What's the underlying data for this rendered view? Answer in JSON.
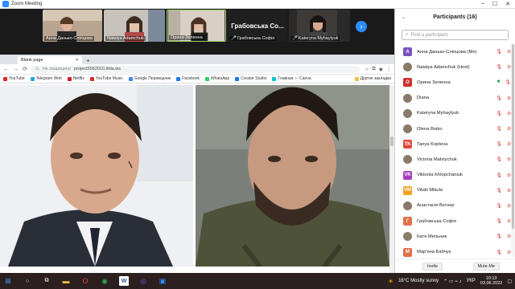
{
  "window": {
    "title": "Zoom Meeting"
  },
  "gallery": {
    "tiles": [
      {
        "name": "Анна Данько-Сліпцова",
        "type": "video"
      },
      {
        "name": "Natalya Adamchuk",
        "type": "video"
      },
      {
        "name": "Орина Зеленна",
        "type": "video"
      },
      {
        "name": "Грабовська Софія",
        "big_label": "Грабовська   Со...",
        "type": "text"
      },
      {
        "name": "Kateryna Myhaylyuk",
        "type": "video"
      }
    ]
  },
  "browser": {
    "tab_title": "Blank page",
    "url_warning": "Не защищено",
    "url": "project5562010.tilda.ws",
    "bookmarks": [
      {
        "label": "YouTube",
        "color": "#e02828"
      },
      {
        "label": "Telegram Web",
        "color": "#2aa3e0"
      },
      {
        "label": "Netflix",
        "color": "#d81f26"
      },
      {
        "label": "YouTube Music",
        "color": "#e02828"
      },
      {
        "label": "Google Переводчик",
        "color": "#4285f4"
      },
      {
        "label": "Facebook",
        "color": "#1877f2"
      },
      {
        "label": "WhatsApp",
        "color": "#25d366"
      },
      {
        "label": "Creator Studio",
        "color": "#1877f2"
      },
      {
        "label": "Главная — Canva",
        "color": "#00c4cc"
      }
    ],
    "other_bookmarks": "Другие закладки"
  },
  "participants": {
    "title": "Participants (16)",
    "search_placeholder": "Find a participant",
    "list": [
      {
        "name": "Анна Данько-Сліпцова (Me)",
        "initial": "А",
        "color": "#7b4fbf",
        "icons": [
          "mic-off",
          "video-off"
        ]
      },
      {
        "name": "Natalya Adamchuk (Host)",
        "initial": "",
        "color": "#8a7a6a",
        "icons": [
          "mic-off",
          "video-off"
        ]
      },
      {
        "name": "Орина Зеленна",
        "initial": "О",
        "color": "#d0312d",
        "icons": [
          "video-on",
          "mic-off"
        ]
      },
      {
        "name": "Diana",
        "initial": "",
        "color": "#8a7a6a",
        "icons": [
          "mic-off",
          "video-off"
        ]
      },
      {
        "name": "Kateryna Myhaylyuk",
        "initial": "",
        "color": "#8a7a6a",
        "icons": [
          "mic-off",
          "video-off"
        ]
      },
      {
        "name": "Olena Boiko",
        "initial": "",
        "color": "#8a7a6a",
        "icons": [
          "mic-off",
          "video-off"
        ]
      },
      {
        "name": "Tanya Kopteva",
        "initial": "TK",
        "color": "#e0473b",
        "icons": [
          "mic-off",
          "video-off"
        ]
      },
      {
        "name": "Victoria Matviychuk",
        "initial": "",
        "color": "#8a7a6a",
        "icons": [
          "mic-off",
          "video-off"
        ]
      },
      {
        "name": "Viktoriia Khlopchaniuk",
        "initial": "VK",
        "color": "#a83bbf",
        "icons": [
          "mic-off",
          "video-off"
        ]
      },
      {
        "name": "Vitalii Mikula",
        "initial": "VM",
        "color": "#f0a020",
        "icons": [
          "mic-off",
          "video-off"
        ]
      },
      {
        "name": "Анастасія Вєгнер",
        "initial": "",
        "color": "#8a7a6a",
        "icons": [
          "mic-off",
          "video-off"
        ]
      },
      {
        "name": "Грабовська  Софія",
        "initial": "Г",
        "color": "#e0704b",
        "icons": [
          "mic-off",
          "video-off"
        ]
      },
      {
        "name": "Катя Мельник",
        "initial": "",
        "color": "#8a7a6a",
        "icons": [
          "mic-off",
          "video-off"
        ]
      },
      {
        "name": "Мар'яна Бабчук",
        "initial": "М",
        "color": "#e0704b",
        "icons": [
          "mic-off",
          "video-off"
        ]
      }
    ],
    "invite_label": "Invite",
    "mute_label": "Mute Me"
  },
  "taskbar": {
    "weather": "16°C  Mostly sunny",
    "language": "УКР",
    "time": "10:13",
    "date": "03.06.2022"
  }
}
